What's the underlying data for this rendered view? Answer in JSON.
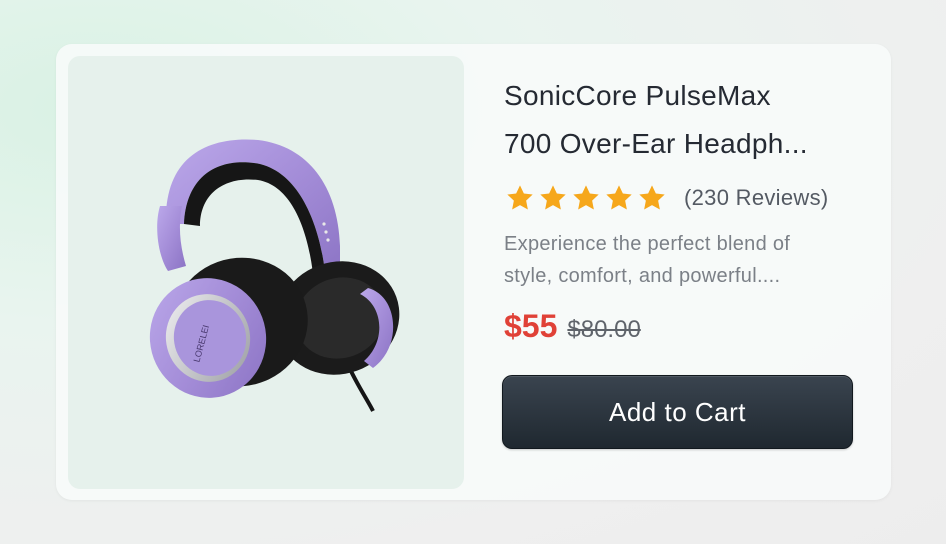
{
  "product": {
    "title_line1": "SonicCore PulseMax",
    "title_line2": "700 Over-Ear Headph...",
    "rating_stars": 5,
    "reviews": "(230 Reviews)",
    "description_line1": "Experience the perfect blend of",
    "description_line2": "style, comfort, and powerful....",
    "price": "$55",
    "old_price": "$80.00",
    "brand_on_earcup": "LORELEI",
    "icon": "headphones-image"
  },
  "actions": {
    "add_to_cart_label": "Add to Cart"
  },
  "colors": {
    "accent_price": "#e04137",
    "star": "#f6a71b",
    "button": "#27313b",
    "headphone": "#a690d8"
  }
}
